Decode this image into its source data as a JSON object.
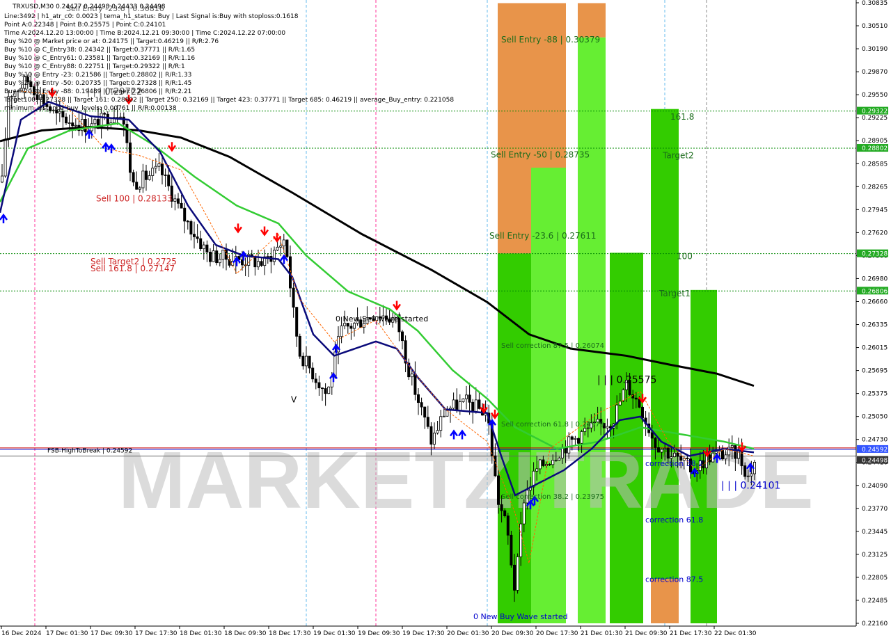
{
  "header": {
    "symbol_line": "TRXUSD,M30  0.24477 0.24498 0.24433 0.24498",
    "info_lines": [
      "Line:3492 | h1_atr_c0: 0.0023 | tema_h1_status: Buy | Last Signal is:Buy with stoploss:0.1618",
      "Point A:0.22348 | Point B:0.25575 | Point C:0.24101",
      "Time A:2024.12.20 13:00:00 | Time B:2024.12.21 09:30:00 | Time C:2024.12.22 07:00:00",
      "Buy %20 @ Market price or at: 0.24175 || Target:0.46219 || R/R:2.76",
      "Buy %10 @ C_Entry38: 0.24342 || Target:0.37771 || R/R:1.65",
      "Buy %10 @ C_Entry61: 0.23581 || Target:0.32169 || R/R:1.16",
      "Buy %10 @ C_Entry88: 0.22751 || Target:0.29322 || R/R:1",
      "Buy %10 @ Entry -23: 0.21586 || Target:0.28802 || R/R:1.33",
      "Buy %20 @ Entry -50: 0.20735 || Target:0.27328 || R/R:1.45",
      "Buy %20 @ Entry -88: 0.19489 || Target:0.26806 || R/R:2.21",
      "Target100: 0.27328 || Target 161: 0.28802 || Target 250: 0.32169 || Target 423: 0.37771 || Target 685: 0.46219 || average_Buy_entry: 0.221058",
      "minimum_distance_buy_levels: 0.00761 || R/R:0.00138"
    ]
  },
  "watermark": "MARKETZITRADE",
  "colors": {
    "bull_zone": "#33cc00",
    "bull_zone_light": "#66ee33",
    "sell_zone": "#e8944a",
    "black_ma": "#000000",
    "green_ma": "#33cc33",
    "navy_ma": "#0a0a7a",
    "orange_line": "#ff6600",
    "level_line": "#008800",
    "blue_arrow": "#0000ff",
    "red_arrow": "#ff0000",
    "current_price_bg": "#3355ff",
    "level_bg": "#22aa22"
  },
  "chart_data": {
    "type": "candlestick",
    "symbol": "TRXUSD",
    "timeframe": "M30",
    "y_range": [
      0.2216,
      0.30835
    ],
    "y_ticks": [
      "0.30835",
      "0.30510",
      "0.30190",
      "0.29870",
      "0.29550",
      "0.29225",
      "0.28905",
      "0.28585",
      "0.28265",
      "0.27945",
      "0.27620",
      "0.27300",
      "0.26980",
      "0.26660",
      "0.26335",
      "0.26015",
      "0.25695",
      "0.25375",
      "0.25050",
      "0.24730",
      "0.24410",
      "0.24090",
      "0.23770",
      "0.23445",
      "0.23125",
      "0.22805",
      "0.22485",
      "0.22160"
    ],
    "x_ticks": [
      "16 Dec 2024",
      "17 Dec 01:30",
      "17 Dec 09:30",
      "17 Dec 17:30",
      "18 Dec 01:30",
      "18 Dec 09:30",
      "18 Dec 17:30",
      "19 Dec 01:30",
      "19 Dec 09:30",
      "19 Dec 17:30",
      "20 Dec 01:30",
      "20 Dec 09:30",
      "20 Dec 17:30",
      "21 Dec 01:30",
      "21 Dec 09:30",
      "21 Dec 17:30",
      "22 Dec 01:30"
    ],
    "current_price": "0.24498",
    "level_labels": [
      {
        "label": "0.29322",
        "value": 0.29322
      },
      {
        "label": "0.28802",
        "value": 0.28802
      },
      {
        "label": "0.27328",
        "value": 0.27328
      },
      {
        "label": "0.26806",
        "value": 0.26806
      },
      {
        "label": "0.24592",
        "value": 0.24592
      },
      {
        "label": "0.24498",
        "value": 0.24498
      }
    ],
    "annotations": {
      "sell_entry_top": "Sell Entry -23.6 | 0.30816",
      "sell_entry_88": "Sell Entry -88 | 0.30379",
      "sell_entry_50": "Sell Entry -50 | 0.28735",
      "sell_entry_236": "Sell Entry -23.6 | 0.27611",
      "sell_correction_875": "Sell correction 87.5 | 0.26074",
      "sell_correction_618": "Sell correction 61.8 | 0.24979",
      "sell_correction_382": "Sell correction 38.2 | 0.23975",
      "sell_100": "Sell 100 | 0.28133",
      "sell_target2": "Sell Target2 | 0.2725",
      "sell_1618": "Sell 161.8 | 0.27147",
      "new_sell_wave": "0 New Sell wave started",
      "new_buy_wave": "0 New Buy Wave started",
      "point_b": "| | | 0.25575",
      "point_c": "| | | 0.24101",
      "top_label": "| | | 0.29722",
      "fsb": "FSB-HighToBreak | 0.24592",
      "lvl_1618": "161.8",
      "target2": "Target2",
      "lvl_100": "100",
      "target1": "Target1",
      "corr_382": "correction 38.2",
      "corr_618": "correction 61.8",
      "corr_875": "correction 87.5",
      "v_mark": "V"
    }
  }
}
